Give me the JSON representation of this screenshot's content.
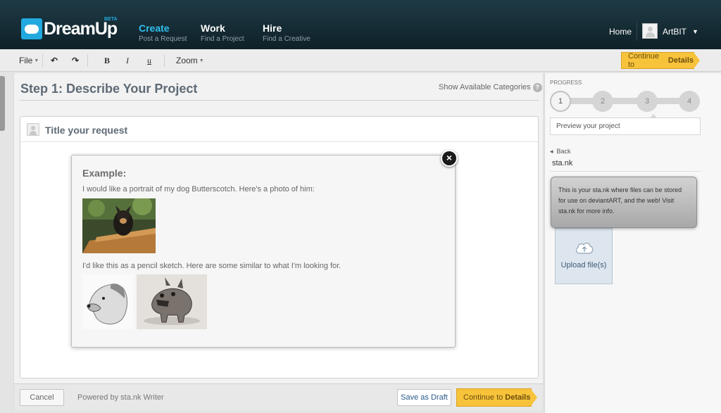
{
  "header": {
    "logo": "DreamUp",
    "logo_badge": "BETA",
    "nav": [
      {
        "title": "Create",
        "subtitle": "Post a Request"
      },
      {
        "title": "Work",
        "subtitle": "Find a Project"
      },
      {
        "title": "Hire",
        "subtitle": "Find a Creative"
      }
    ],
    "home": "Home",
    "username": "ArtBIT",
    "user_caret": "▼"
  },
  "toolbar": {
    "file": "File",
    "undo": "↶",
    "redo": "↷",
    "bold": "B",
    "italic": "I",
    "underline": "u",
    "zoom": "Zoom",
    "caret": "▼",
    "continue_prefix": "Continue to",
    "continue_bold": "Details"
  },
  "main": {
    "step_title": "Step 1: Describe Your Project",
    "show_categories": "Show Available Categories",
    "help": "?",
    "card_title": "Title your request",
    "example": {
      "heading": "Example:",
      "line1": "I would like a portrait of my dog Butterscotch. Here's a photo of him:",
      "line2": "I'd like this as a pencil sketch. Here are some similar to what I'm looking for."
    },
    "close": "×"
  },
  "footer": {
    "cancel": "Cancel",
    "powered": "Powered by sta.nk Writer",
    "save_draft": "Save as Draft",
    "continue_prefix": "Continue to",
    "continue_bold": "Details"
  },
  "sidebar": {
    "progress_label": "PROGRESS",
    "steps": [
      "1",
      "2",
      "3",
      "4"
    ],
    "preview": "Preview your project",
    "back": "Back",
    "back_arrow": "◂",
    "stank": "sta.nk",
    "tooltip": "This is your sta.nk where files can be stored for use on deviantART, and the web! Visit sta.nk for more info.",
    "upload": "Upload file(s)"
  }
}
